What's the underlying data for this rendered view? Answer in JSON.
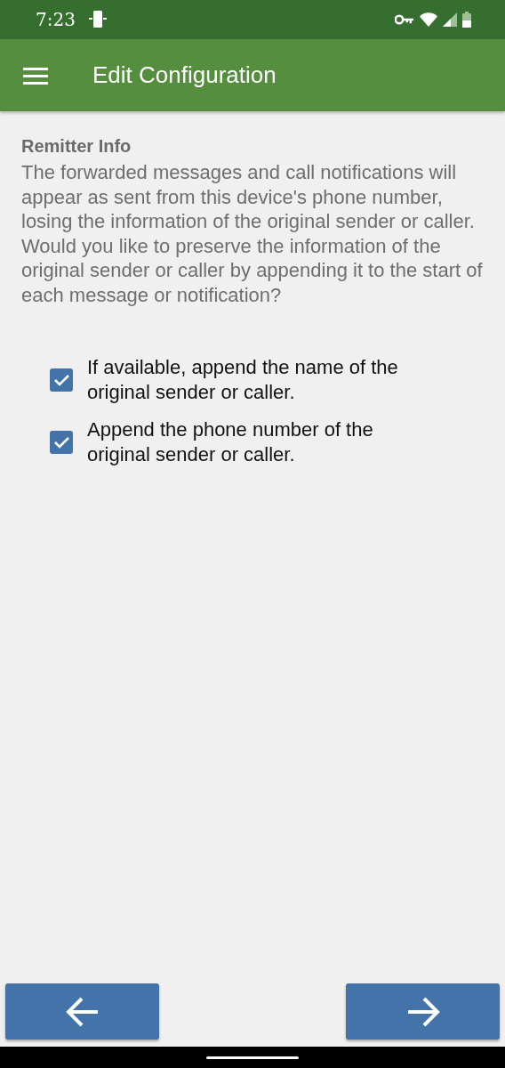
{
  "status_bar": {
    "time": "7:23"
  },
  "app_bar": {
    "title": "Edit Configuration"
  },
  "section": {
    "heading": "Remitter Info",
    "description": "The forwarded messages and call notifications will appear as sent from this device's phone number, losing the information of the original sender or caller. Would you like to preserve the information of the original sender or caller by appending it to the start of each message or notification?"
  },
  "options": [
    {
      "label": "If available, append the name of the original sender or caller.",
      "checked": true
    },
    {
      "label": "Append the phone number of the original sender or caller.",
      "checked": true
    }
  ]
}
